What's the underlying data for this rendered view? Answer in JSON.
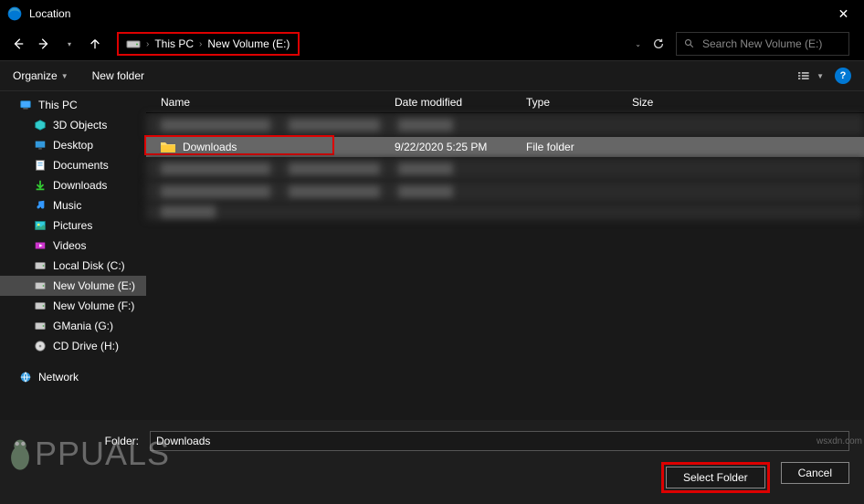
{
  "window": {
    "title": "Location",
    "close": "✕"
  },
  "nav": {
    "breadcrumb": {
      "root": "This PC",
      "current": "New Volume (E:)"
    },
    "search_placeholder": "Search New Volume (E:)"
  },
  "toolbar": {
    "organize": "Organize",
    "newfolder": "New folder"
  },
  "columns": {
    "name": "Name",
    "date": "Date modified",
    "type": "Type",
    "size": "Size"
  },
  "sidebar": {
    "items": [
      {
        "label": "This PC",
        "kind": "pc",
        "indent": 0
      },
      {
        "label": "3D Objects",
        "kind": "3d",
        "indent": 1
      },
      {
        "label": "Desktop",
        "kind": "desktop",
        "indent": 1
      },
      {
        "label": "Documents",
        "kind": "docs",
        "indent": 1
      },
      {
        "label": "Downloads",
        "kind": "down",
        "indent": 1
      },
      {
        "label": "Music",
        "kind": "music",
        "indent": 1
      },
      {
        "label": "Pictures",
        "kind": "pics",
        "indent": 1
      },
      {
        "label": "Videos",
        "kind": "vids",
        "indent": 1
      },
      {
        "label": "Local Disk (C:)",
        "kind": "disk",
        "indent": 1
      },
      {
        "label": "New Volume (E:)",
        "kind": "disk",
        "indent": 1,
        "selected": true
      },
      {
        "label": "New Volume (F:)",
        "kind": "disk",
        "indent": 1
      },
      {
        "label": "GMania (G:)",
        "kind": "disk",
        "indent": 1
      },
      {
        "label": "CD Drive (H:)",
        "kind": "cd",
        "indent": 1
      },
      {
        "label": "Network",
        "kind": "net",
        "indent": 0
      }
    ]
  },
  "files": {
    "selected": {
      "name": "Downloads",
      "date": "9/22/2020 5:25 PM",
      "type": "File folder",
      "size": ""
    }
  },
  "bottom": {
    "folder_label": "Folder:",
    "folder_value": "Downloads",
    "select": "Select Folder",
    "cancel": "Cancel"
  },
  "watermark": {
    "text": "PPUALS",
    "corner": "wsxdn.com"
  }
}
